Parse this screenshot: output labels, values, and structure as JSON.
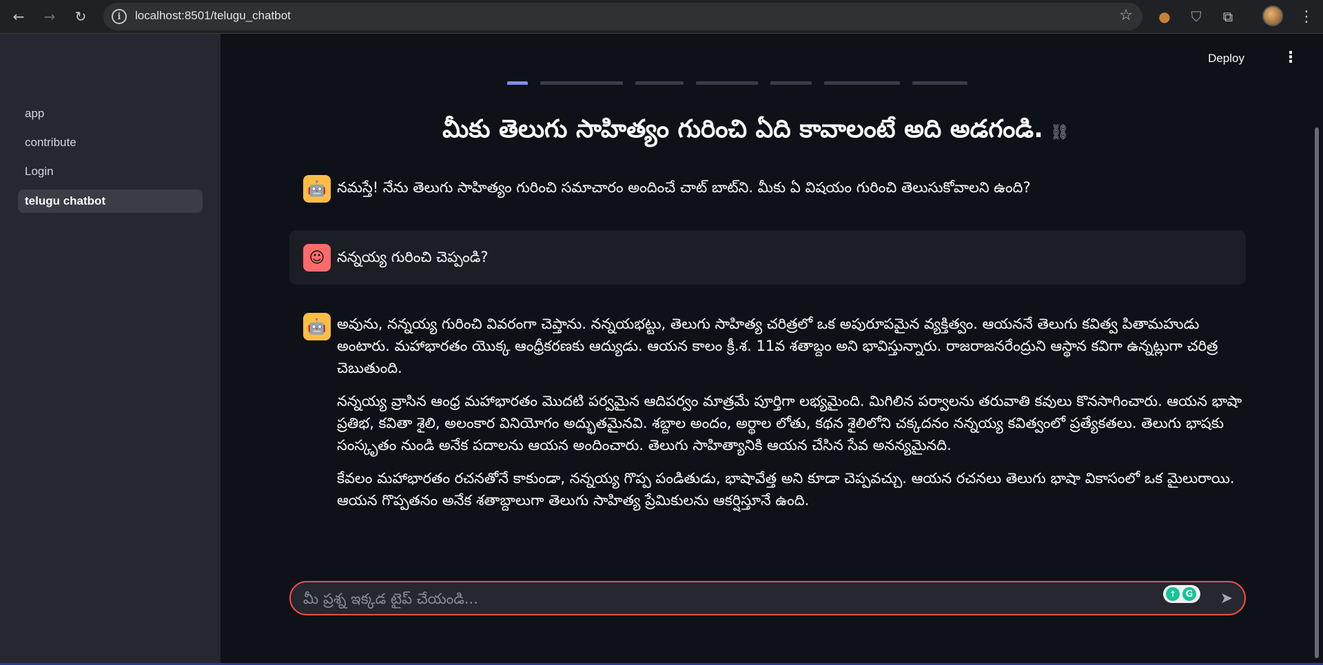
{
  "browser": {
    "url": "localhost:8501/telugu_chatbot",
    "back_icon": "←",
    "forward_icon": "→",
    "reload_icon": "↻",
    "info_icon": "i",
    "star_icon": "☆",
    "cookie_icon": "●",
    "shield_icon": "⛉",
    "puzzle_icon": "⧉",
    "menu_icon": "⋮"
  },
  "sidebar": {
    "items": [
      {
        "label": "app"
      },
      {
        "label": "contribute"
      },
      {
        "label": "Login"
      },
      {
        "label": "telugu chatbot",
        "active": true
      }
    ]
  },
  "header": {
    "deploy_label": "Deploy",
    "menu_icon": "⋮"
  },
  "page": {
    "heading": "మీకు తెలుగు సాహిత్యం గురించి ఏది కావాలంటే అది అడగండి.",
    "link_icon": "⛓"
  },
  "messages": [
    {
      "role": "assistant",
      "avatar_icon": "🤖",
      "paragraphs": [
        "నమస్తే! నేను తెలుగు సాహిత్యం గురించి సమాచారం అందించే చాట్ బాట్‌ని. మీకు ఏ విషయం గురించి తెలుసుకోవాలని ఉంది?"
      ]
    },
    {
      "role": "user",
      "avatar_icon": "☺",
      "paragraphs": [
        "నన్నయ్య గురించి చెప్పండి?"
      ]
    },
    {
      "role": "assistant",
      "avatar_icon": "🤖",
      "paragraphs": [
        "అవును, నన్నయ్య గురించి వివరంగా చెప్తాను. నన్నయభట్టు, తెలుగు సాహిత్య చరిత్రలో ఒక అపురూపమైన వ్యక్తిత్వం. ఆయననే తెలుగు కవిత్వ పితామహుడు అంటారు. మహాభారతం యొక్క ఆంధ్రీకరణకు ఆద్యుడు. ఆయన కాలం క్రీ.శ. 11వ శతాబ్దం అని భావిస్తున్నారు. రాజరాజనరేంద్రుని ఆస్థాన కవిగా ఉన్నట్లుగా చరిత్ర చెబుతుంది.",
        "నన్నయ్య వ్రాసిన ఆంధ్ర మహాభారతం మొదటి పర్వమైన ఆదిపర్వం మాత్రమే పూర్తిగా లభ్యమైంది. మిగిలిన పర్వాలను తరువాతి కవులు కొనసాగించారు. ఆయన భాషా ప్రతిభ, కవితా శైలి, అలంకార వినియోగం అద్భుతమైనవి. శబ్దాల అందం, అర్థాల లోతు, కథన శైలిలోని చక్కదనం నన్నయ్య కవిత్వంలో ప్రత్యేకతలు. తెలుగు భాషకు సంస్కృతం నుండి అనేక పదాలను ఆయన అందించారు. తెలుగు సాహిత్యానికి ఆయన చేసిన సేవ అనన్యమైనది.",
        "కేవలం మహాభారతం రచనతోనే కాకుండా, నన్నయ్య గొప్ప పండితుడు, భాషావేత్త అని కూడా చెప్పవచ్చు. ఆయన రచనలు తెలుగు భాషా వికాసంలో ఒక మైలురాయి. ఆయన గొప్పతనం అనేక శతాబ్దాలుగా తెలుగు సాహిత్య ప్రేమికులను ఆకర్షిస్తూనే ఉంది."
      ]
    }
  ],
  "chat_input": {
    "placeholder": "మీ ప్రశ్న ఇక్కడ టైప్ చేయండి...",
    "send_icon": "➤",
    "grammarly_icon_1": "↑",
    "grammarly_icon_2": "G"
  },
  "colors": {
    "accent": "#ff4b4b",
    "bot_avatar": "#ffbd45",
    "user_avatar": "#ff6b6b",
    "sidebar_bg": "#262730",
    "main_bg": "#0e1117"
  }
}
